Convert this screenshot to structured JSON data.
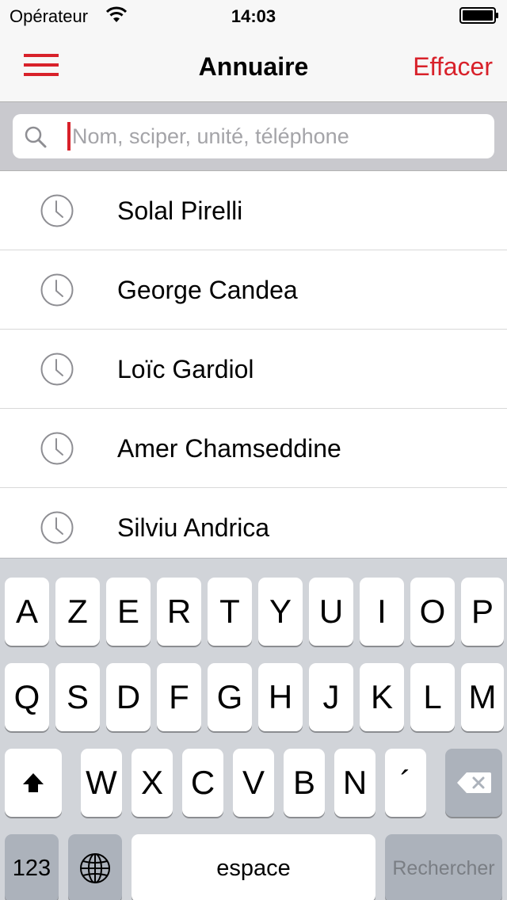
{
  "status_bar": {
    "carrier": "Opérateur",
    "time": "14:03"
  },
  "nav": {
    "title": "Annuaire",
    "clear_label": "Effacer",
    "accent_color": "#d8212a"
  },
  "search": {
    "placeholder": "Nom, sciper, unité, téléphone",
    "value": ""
  },
  "recents": [
    {
      "name": "Solal Pirelli",
      "icon": "clock-icon"
    },
    {
      "name": "George Candea",
      "icon": "clock-icon"
    },
    {
      "name": "Loïc Gardiol",
      "icon": "clock-icon"
    },
    {
      "name": "Amer Chamseddine",
      "icon": "clock-icon"
    },
    {
      "name": "Silviu Andrica",
      "icon": "clock-icon"
    }
  ],
  "keyboard": {
    "row1": [
      "A",
      "Z",
      "E",
      "R",
      "T",
      "Y",
      "U",
      "I",
      "O",
      "P"
    ],
    "row2": [
      "Q",
      "S",
      "D",
      "F",
      "G",
      "H",
      "J",
      "K",
      "L",
      "M"
    ],
    "row3": [
      "W",
      "X",
      "C",
      "V",
      "B",
      "N",
      "´"
    ],
    "numbers_label": "123",
    "space_label": "espace",
    "search_label": "Rechercher",
    "shift_icon": "shift-icon",
    "delete_icon": "delete-icon",
    "globe_icon": "globe-icon"
  }
}
